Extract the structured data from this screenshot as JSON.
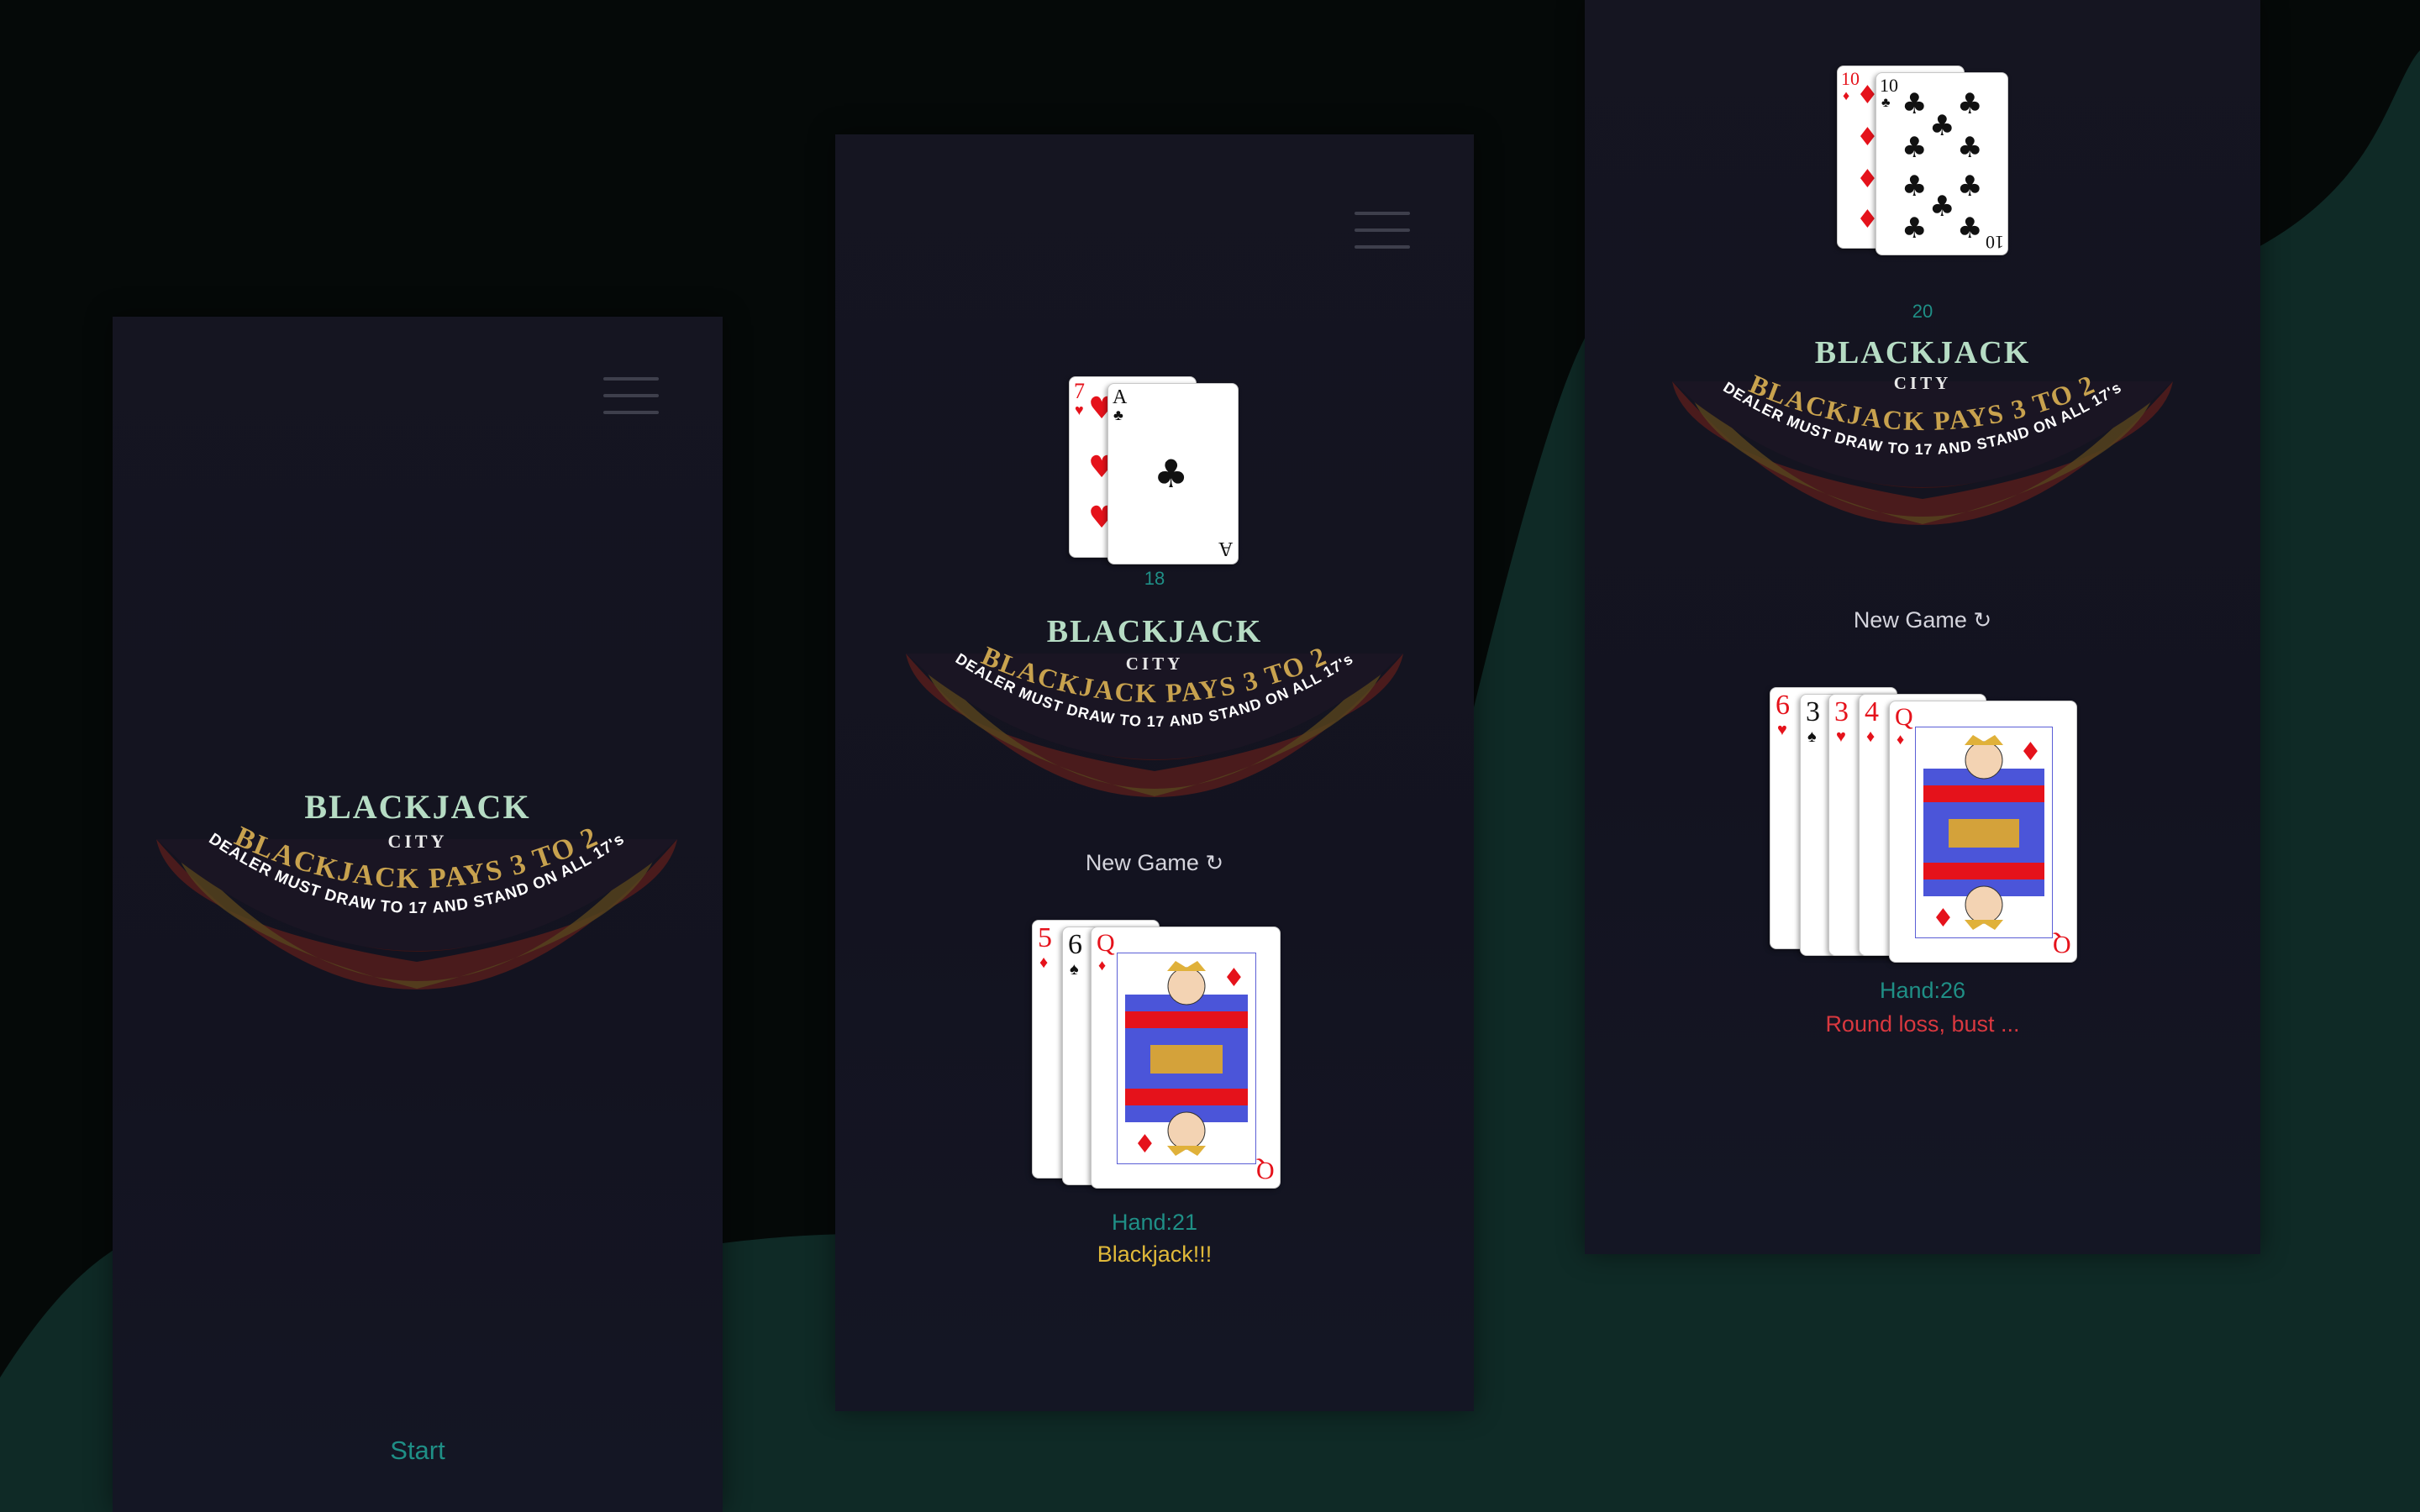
{
  "colors": {
    "felt": "#0f2a26",
    "dark": "#050908",
    "accent": "#1f8f86",
    "gold": "#c8a24e",
    "title": "#b6dcc4",
    "loss": "#d9383f",
    "win": "#e0b93a"
  },
  "logo": {
    "title": "BLACKJACK",
    "subtitle": "CITY",
    "arc_text": "BLACKJACK PAYS 3 TO 2",
    "arc_subtext": "DEALER MUST DRAW TO 17 AND STAND ON ALL 17's"
  },
  "screens": [
    {
      "menu_icon": "hamburger-icon",
      "start_label": "Start"
    },
    {
      "menu_icon": "hamburger-icon",
      "dealer": {
        "score": "18",
        "cards": [
          {
            "rank": "7",
            "suit": "♥"
          },
          {
            "rank": "A",
            "suit": "♣"
          }
        ]
      },
      "new_game_label": "New Game",
      "refresh_icon": "refresh-icon",
      "player": {
        "cards": [
          {
            "rank": "5",
            "suit": "♦"
          },
          {
            "rank": "6",
            "suit": "♠"
          },
          {
            "rank": "Q",
            "suit": "♦"
          }
        ],
        "hand_label": "Hand:21",
        "result": "Blackjack!!!"
      }
    },
    {
      "dealer": {
        "score": "20",
        "cards": [
          {
            "rank": "10",
            "suit": "♦"
          },
          {
            "rank": "10",
            "suit": "♣"
          }
        ]
      },
      "new_game_label": "New Game",
      "refresh_icon": "refresh-icon",
      "player": {
        "cards": [
          {
            "rank": "6",
            "suit": "♥"
          },
          {
            "rank": "3",
            "suit": "♠"
          },
          {
            "rank": "3",
            "suit": "♥"
          },
          {
            "rank": "4",
            "suit": "♦"
          },
          {
            "rank": "Q",
            "suit": "♦"
          }
        ],
        "hand_label": "Hand:26",
        "result": "Round loss, bust ..."
      }
    }
  ]
}
